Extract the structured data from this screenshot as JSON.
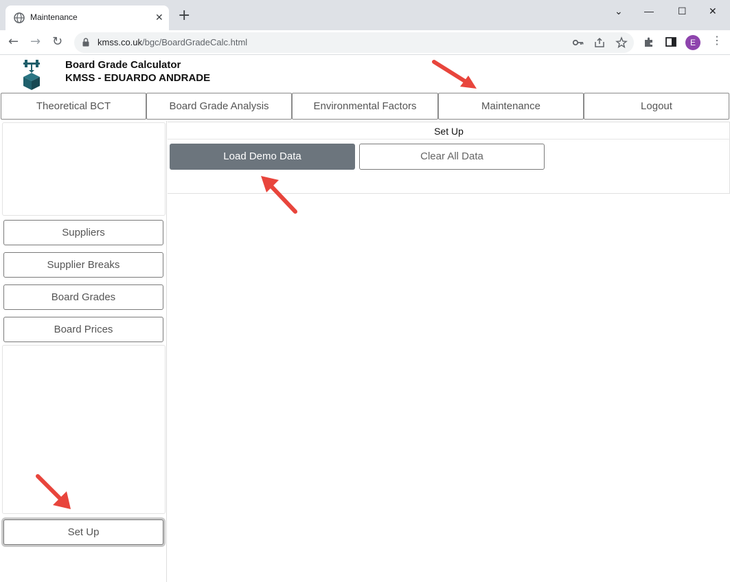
{
  "browser": {
    "tab_title": "Maintenance",
    "close_glyph": "✕",
    "new_tab_glyph": "+",
    "minimize_glyph": "—",
    "maximize_glyph": "☐",
    "window_close_glyph": "✕",
    "dropdown_glyph": "⌄",
    "back_glyph": "←",
    "forward_glyph": "→",
    "reload_glyph": "↻",
    "url_domain": "kmss.co.uk",
    "url_path": "/bgc/BoardGradeCalc.html",
    "avatar_letter": "E",
    "menu_glyph": "⋮"
  },
  "app": {
    "title": "Board Grade Calculator",
    "subtitle": "KMSS - EDUARDO ANDRADE",
    "logo_color": "#1f5f6b"
  },
  "nav": {
    "tabs": [
      {
        "label": "Theoretical BCT"
      },
      {
        "label": "Board Grade Analysis"
      },
      {
        "label": "Environmental Factors"
      },
      {
        "label": "Maintenance"
      },
      {
        "label": "Logout"
      }
    ]
  },
  "sidebar": {
    "items": [
      {
        "label": "Suppliers"
      },
      {
        "label": "Supplier Breaks"
      },
      {
        "label": "Board Grades"
      },
      {
        "label": "Board Prices"
      }
    ],
    "setup_label": "Set Up"
  },
  "main": {
    "title": "Set Up",
    "load_demo_label": "Load Demo Data",
    "clear_all_label": "Clear All Data"
  },
  "colors": {
    "arrow": "#e8453c",
    "primary_button": "#6c757d"
  }
}
